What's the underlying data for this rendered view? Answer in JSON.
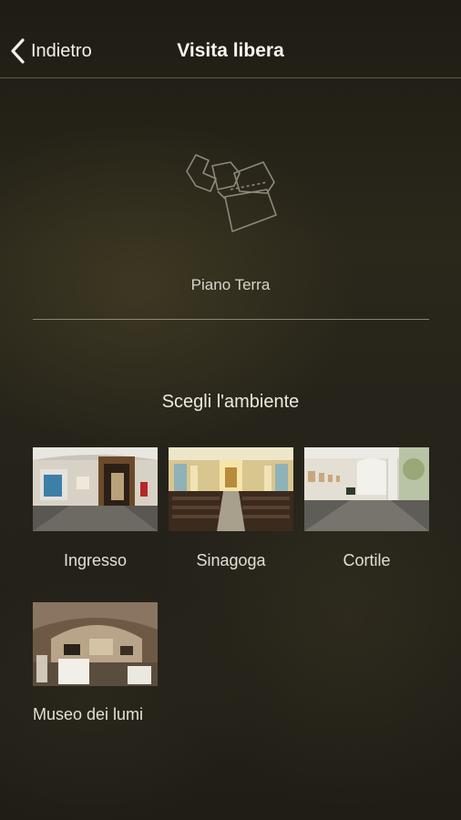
{
  "header": {
    "back_label": "Indietro",
    "title": "Visita libera"
  },
  "floor": {
    "label": "Piano Terra",
    "icon": "floor-plan-icon"
  },
  "rooms_section": {
    "title": "Scegli l'ambiente",
    "rooms": [
      {
        "label": "Ingresso"
      },
      {
        "label": "Sinagoga"
      },
      {
        "label": "Cortile"
      },
      {
        "label": "Museo dei lumi"
      }
    ]
  }
}
